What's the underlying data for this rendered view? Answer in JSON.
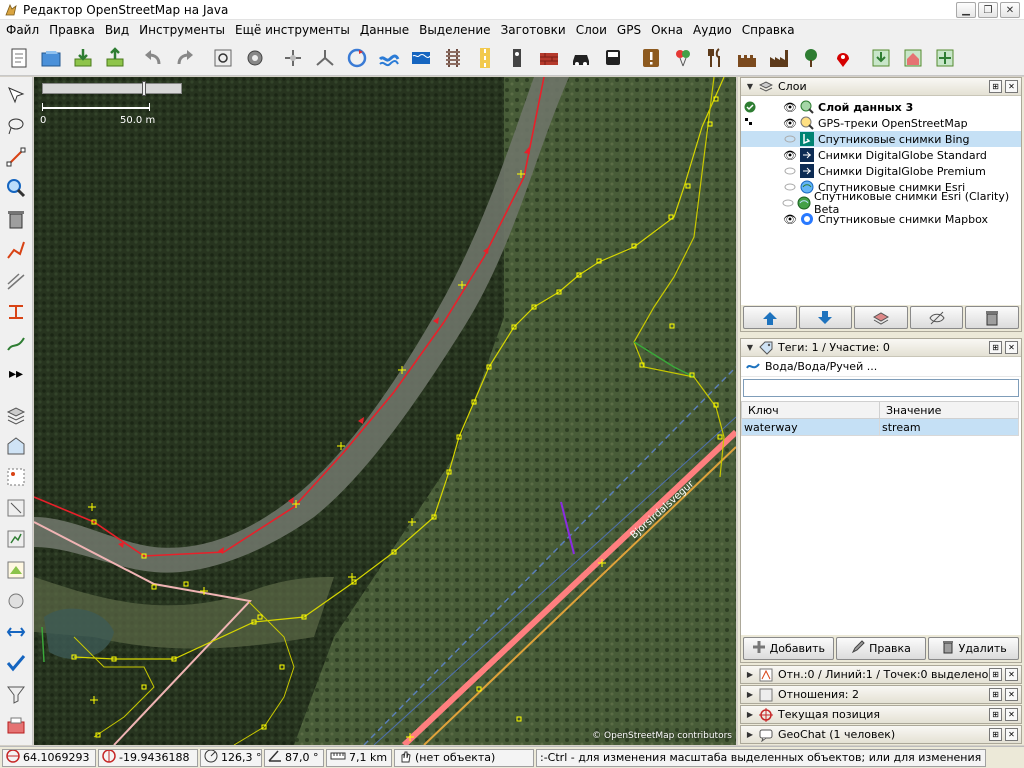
{
  "window": {
    "title": "Редактор OpenStreetMap на Java"
  },
  "menu": [
    "Файл",
    "Правка",
    "Вид",
    "Инструменты",
    "Ещё инструменты",
    "Данные",
    "Выделение",
    "Заготовки",
    "Слои",
    "GPS",
    "Окна",
    "Аудио",
    "Справка"
  ],
  "map": {
    "scale_zero": "0",
    "scale_value": "50.0 m",
    "credit": "© OpenStreetMap contributors",
    "road_label": "Bjorsirdalsvegur"
  },
  "layers_panel": {
    "title": "Слои",
    "items": [
      {
        "name": "Слой данных 3",
        "active": true,
        "visible": true,
        "icon": "data-layer-icon"
      },
      {
        "name": "GPS-треки OpenStreetMap",
        "visible": true,
        "icon": "gps-track-icon"
      },
      {
        "name": "Спутниковые снимки Bing",
        "visible": false,
        "selected": true,
        "icon": "bing-icon"
      },
      {
        "name": "Снимки DigitalGlobe Standard",
        "visible": true,
        "icon": "digitalglobe-icon"
      },
      {
        "name": "Снимки DigitalGlobe Premium",
        "visible": false,
        "icon": "digitalglobe-icon"
      },
      {
        "name": "Спутниковые снимки Esri",
        "visible": false,
        "icon": "esri-icon"
      },
      {
        "name": "Спутниковые снимки Esri (Clarity) Beta",
        "visible": false,
        "icon": "esri-icon"
      },
      {
        "name": "Спутниковые снимки Mapbox",
        "visible": true,
        "icon": "mapbox-icon"
      }
    ]
  },
  "tags_panel": {
    "title": "Теги: 1 / Участие: 0",
    "preset": "Вода/Вода/Ручей ...",
    "col_key": "Ключ",
    "col_value": "Значение",
    "rows": [
      {
        "key": "waterway",
        "value": "stream"
      }
    ],
    "add_label": "Добавить",
    "edit_label": "Правка",
    "delete_label": "Удалить"
  },
  "collapsed_panels": {
    "selection": "Отн.:0 / Линий:1 / Точек:0 выделено",
    "relations": "Отношения: 2",
    "position": "Текущая позиция",
    "geochat": "GeoChat (1 человек)"
  },
  "status": {
    "lat": "64.1069293",
    "lon": "-19.9436188",
    "heading": "126,3 °",
    "angle": "87,0 °",
    "distance": "7,1 km",
    "object": "(нет объекта)",
    "hint": ":-Ctrl - для изменения масштаба выделенных объектов; или для изменения выделения"
  },
  "colors": {
    "waterway": "#e8202a",
    "track": "#d6d600",
    "node": "#ffff00",
    "road": "#ff7f7f",
    "selected_row": "#c5e0f5"
  }
}
